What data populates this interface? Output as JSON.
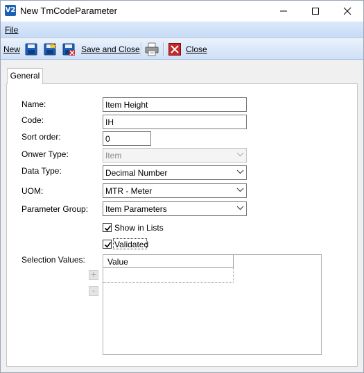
{
  "window": {
    "title": "New TmCodeParameter",
    "app_icon": "V2",
    "controls": {
      "minimize": "minimize-icon",
      "maximize": "maximize-icon",
      "close": "close-icon"
    }
  },
  "menu": {
    "file": "File"
  },
  "toolbar": {
    "new_label": "New",
    "save_close_label": "Save and Close",
    "close_label": "Close"
  },
  "tabs": [
    {
      "label": "General",
      "active": true
    }
  ],
  "form": {
    "name": {
      "label": "Name:",
      "value": "Item Height"
    },
    "code": {
      "label": "Code:",
      "value": "IH"
    },
    "sort_order": {
      "label": "Sort order:",
      "value": "0"
    },
    "owner_type": {
      "label": "Onwer Type:",
      "value": "Item",
      "disabled": true
    },
    "data_type": {
      "label": "Data Type:",
      "value": "Decimal Number"
    },
    "uom": {
      "label": "UOM:",
      "value": "MTR - Meter"
    },
    "parameter_group": {
      "label": "Parameter Group:",
      "value": "Item Parameters"
    },
    "show_in_lists": {
      "label": "Show in Lists",
      "checked": true
    },
    "validated": {
      "label": "Validated",
      "checked": true
    },
    "selection_values": {
      "label": "Selection Values:",
      "add_label": "+",
      "remove_label": "-",
      "columns": [
        "Value"
      ]
    }
  },
  "colors": {
    "menubar": "#c6dbf6",
    "toolbar": "#cfe0f7",
    "app_icon": "#1c5fb3",
    "delete_red": "#c62828"
  }
}
